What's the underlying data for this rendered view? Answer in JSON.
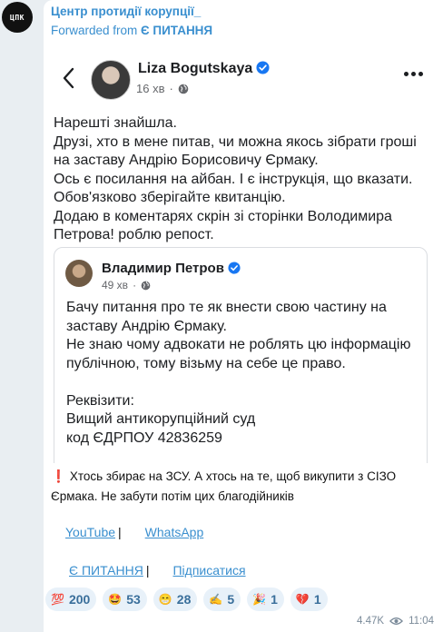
{
  "channel": {
    "avatar_text": "ЦПК",
    "name": "Центр протидії корупції_",
    "forwarded_prefix": "Forwarded from ",
    "forwarded_source": "Є ПИТАННЯ"
  },
  "fb_post": {
    "author": "Liza Bogutskaya",
    "time": "16 хв",
    "text": "Нарешті знайшла.\nДрузі, хто в мене питав, чи можна якось зібрати гроші на заставу Андрію Борисовичу Єрмаку.\nОсь є посилання на айбан. І є інструкція, що вказати. Обов'язково зберігайте квитанцію.\nДодаю в коментарях скрін зі сторінки Володимира Петровa! роблю репост.",
    "shared": {
      "author": "Владимир Петров",
      "time": "49 хв",
      "text": "Бачу питання про те як внести свою частину на заставу Андрію Єрмаку.\nНе знаю чому адвокати не роблять цю інформацію публічною, тому візьму на себе це право.\n\nРеквізити:\nВищий антикорупційний суд\nкод ЄДРПОУ 42836259"
    }
  },
  "caption": {
    "mark": "❗",
    "text": "Хтось збирає на ЗСУ. А хтось на те, щоб викупити з СІЗО Єрмака. Не забути потім цих благодійників"
  },
  "links": {
    "youtube": "YouTube",
    "whatsapp": "WhatsApp",
    "source": "Є ПИТАННЯ",
    "subscribe": "Підписатися",
    "separator": "|"
  },
  "reactions": [
    {
      "emoji": "💯",
      "count": "200",
      "color": "#e0323a"
    },
    {
      "emoji": "🤩",
      "count": "53",
      "color": "#e8a21a"
    },
    {
      "emoji": "😁",
      "count": "28",
      "color": "#e8a21a"
    },
    {
      "emoji": "✍",
      "count": "5",
      "color": "#d9941a"
    },
    {
      "emoji": "🎉",
      "count": "1",
      "color": "#c94fd6"
    },
    {
      "emoji": "💔",
      "count": "1",
      "color": "#d62b2b"
    }
  ],
  "footer": {
    "views": "4.47K",
    "time": "11:04"
  },
  "colors": {
    "accent": "#3a8fcf",
    "verified": "#1877f2"
  }
}
